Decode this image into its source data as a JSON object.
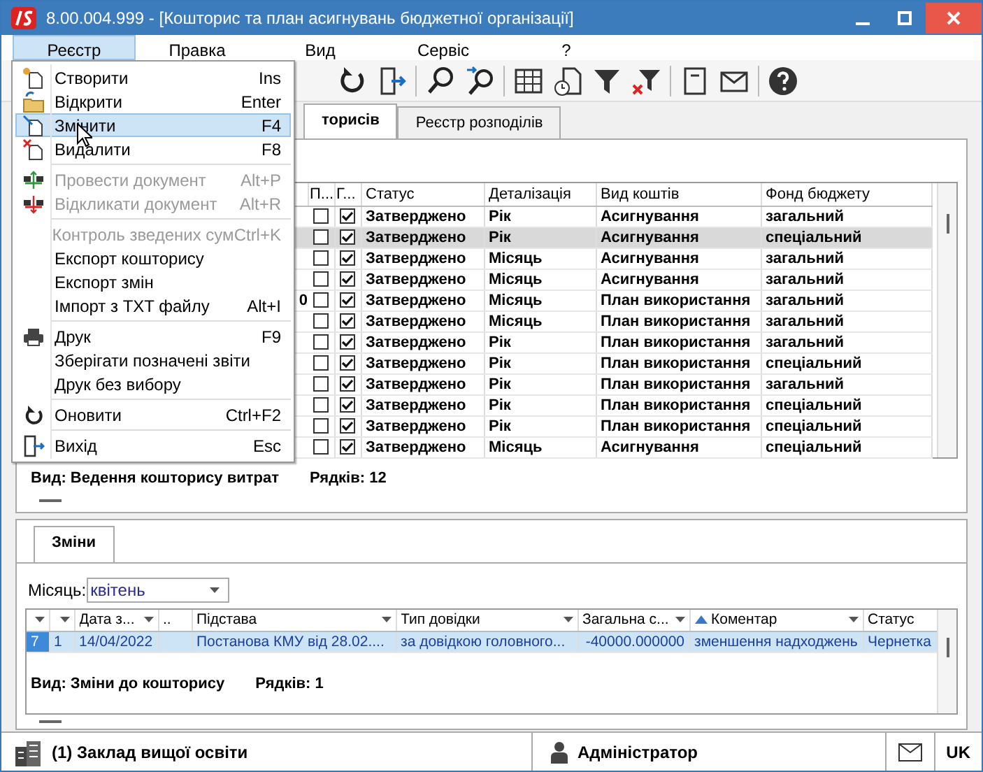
{
  "window": {
    "title": "8.00.004.999 - [Кошторис та план асигнувань бюджетної організації]"
  },
  "menu_bar": [
    {
      "label": "Реєстр",
      "selected": true
    },
    {
      "label": "Правка",
      "selected": false
    },
    {
      "label": "Вид",
      "selected": false
    },
    {
      "label": "Сервіс",
      "selected": false
    },
    {
      "label": "?",
      "selected": false
    }
  ],
  "dropdown_menu": {
    "groups": [
      [
        {
          "label": "Створити",
          "shortcut": "Ins",
          "disabled": false,
          "selected": false
        },
        {
          "label": "Відкрити",
          "shortcut": "Enter",
          "disabled": false,
          "selected": false
        },
        {
          "label": "Змінити",
          "shortcut": "F4",
          "disabled": false,
          "selected": true
        },
        {
          "label": "Видалити",
          "shortcut": "F8",
          "disabled": false,
          "selected": false
        }
      ],
      [
        {
          "label": "Провести документ",
          "shortcut": "Alt+P",
          "disabled": true,
          "selected": false
        },
        {
          "label": "Відкликати документ",
          "shortcut": "Alt+R",
          "disabled": true,
          "selected": false
        }
      ],
      [
        {
          "label": "Контроль зведених сум",
          "shortcut": "Ctrl+K",
          "disabled": true,
          "selected": false
        },
        {
          "label": "Експорт кошторису",
          "disabled": false,
          "selected": false
        },
        {
          "label": "Експорт змін",
          "disabled": false,
          "selected": false
        },
        {
          "label": "Імпорт з TXT файлу",
          "shortcut": "Alt+I",
          "disabled": false,
          "selected": false
        }
      ],
      [
        {
          "label": "Друк",
          "shortcut": "F9",
          "disabled": false,
          "selected": false
        },
        {
          "label": "Зберігати позначені звіти",
          "disabled": false,
          "selected": false
        },
        {
          "label": "Друк без вибору",
          "disabled": false,
          "selected": false
        }
      ],
      [
        {
          "label": "Оновити",
          "shortcut": "Ctrl+F2",
          "disabled": false,
          "selected": false
        }
      ],
      [
        {
          "label": "Вихід",
          "shortcut": "Esc",
          "disabled": false,
          "selected": false
        }
      ]
    ]
  },
  "tabs": [
    {
      "label": "торисів",
      "selected": true
    },
    {
      "label": "Реєстр розподілів",
      "selected": false
    }
  ],
  "main_grid": {
    "columns": [
      "П...",
      "Г...",
      "Статус",
      "Деталізація",
      "Вид коштів",
      "Фонд бюджету"
    ],
    "rows": [
      {
        "checked_1": false,
        "checked_2": true,
        "status": "Затверджено",
        "detail": "Рік",
        "funds_type": "Асигнування",
        "budget_fund": "загальний",
        "selected": false
      },
      {
        "checked_1": false,
        "checked_2": true,
        "status": "Затверджено",
        "detail": "Рік",
        "funds_type": "Асигнування",
        "budget_fund": "спеціальний",
        "selected": true
      },
      {
        "checked_1": false,
        "checked_2": true,
        "status": "Затверджено",
        "detail": "Місяць",
        "funds_type": "Асигнування",
        "budget_fund": "загальний",
        "selected": false
      },
      {
        "checked_1": false,
        "checked_2": true,
        "status": "Затверджено",
        "detail": "Місяць",
        "funds_type": "Асигнування",
        "budget_fund": "загальний",
        "selected": false
      },
      {
        "column_1": "0",
        "checked_1": false,
        "checked_2": true,
        "status": "Затверджено",
        "detail": "Місяць",
        "funds_type": "План використання",
        "budget_fund": "загальний",
        "selected": false
      },
      {
        "checked_1": false,
        "checked_2": true,
        "status": "Затверджено",
        "detail": "Місяць",
        "funds_type": "План використання",
        "budget_fund": "загальний",
        "selected": false
      },
      {
        "checked_1": false,
        "checked_2": true,
        "status": "Затверджено",
        "detail": "Рік",
        "funds_type": "План використання",
        "budget_fund": "загальний",
        "selected": false
      },
      {
        "checked_1": false,
        "checked_2": true,
        "status": "Затверджено",
        "detail": "Рік",
        "funds_type": "План використання",
        "budget_fund": "спеціальний",
        "selected": false
      },
      {
        "checked_1": false,
        "checked_2": true,
        "status": "Затверджено",
        "detail": "Рік",
        "funds_type": "План використання",
        "budget_fund": "загальний",
        "selected": false
      },
      {
        "checked_1": false,
        "checked_2": true,
        "status": "Затверджено",
        "detail": "Рік",
        "funds_type": "План використання",
        "budget_fund": "спеціальний",
        "selected": false
      },
      {
        "checked_1": false,
        "checked_2": true,
        "status": "Затверджено",
        "detail": "Рік",
        "funds_type": "План використання",
        "budget_fund": "спеціальний",
        "selected": false
      },
      {
        "checked_1": false,
        "checked_2": true,
        "status": "Затверджено",
        "detail": "Місяць",
        "funds_type": "Асигнування",
        "budget_fund": "спеціальний",
        "selected": false
      }
    ],
    "view": "Вид: Ведення кошторису витрат",
    "row_count": "Рядків: 12"
  },
  "changes_panel": {
    "tab": {
      "label": "Зміни",
      "selected": true
    },
    "month": {
      "label": "Місяць:",
      "value": "квітень"
    },
    "columns": [
      {
        "sorted_ascending": false
      },
      {
        "sorted_ascending": false
      },
      {
        "label": "Дата з...",
        "sorted_ascending": false
      },
      {
        "label": "..",
        "sorted_ascending": false
      },
      {
        "label": "Підстава",
        "sorted_ascending": false
      },
      {
        "label": "Тип довідки",
        "sorted_ascending": false
      },
      {
        "label": "Загальна с...",
        "sorted_ascending": false
      },
      {
        "label": "Коментар",
        "sorted_ascending": true
      },
      {
        "label": "Статус",
        "sorted_ascending": false
      }
    ],
    "rows": [
      {
        "cells": [
          "7",
          "1",
          "14/04/2022",
          null,
          "Постанова КМУ від 28.02....",
          "за довідкою головного...",
          "-40000.000000",
          "зменшення надходжень",
          "Чернетка"
        ],
        "selected": true
      }
    ],
    "view": "Вид: Зміни до кошторису",
    "row_count": "Рядків: 1"
  },
  "status_bar": {
    "organization": "(1) Заклад вищої освіти",
    "user": "Адміністратор",
    "language": "UK"
  }
}
